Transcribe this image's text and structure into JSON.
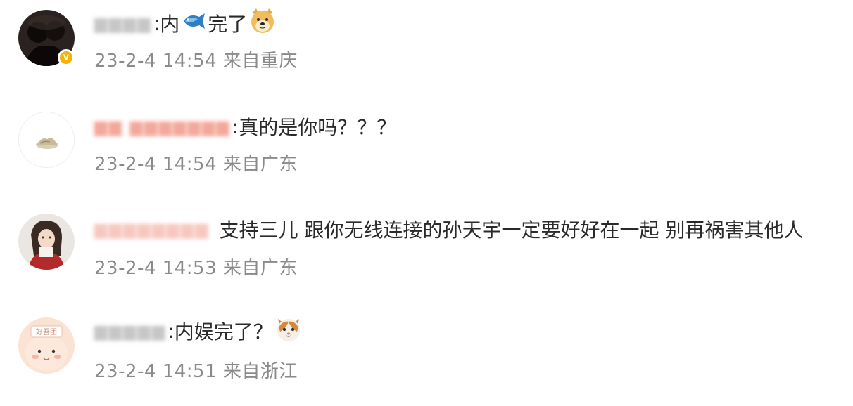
{
  "comments": [
    {
      "separator": ":",
      "text_before_emoji": "内",
      "emoji": "fish-icon",
      "text_after_emoji": "完了",
      "trailing_emoji": "doge-icon",
      "timestamp": "23-2-4 14:54",
      "location": "来自重庆",
      "verified": true
    },
    {
      "separator": ":",
      "text": "真的是你吗？？？",
      "timestamp": "23-2-4 14:54",
      "location": "来自广东"
    },
    {
      "text": "支持三儿 跟你无线连接的孙天宇一定要好好在一起 别再祸害其他人",
      "timestamp": "23-2-4 14:53",
      "location": "来自广东"
    },
    {
      "separator": ":",
      "text": "内娱完了？",
      "trailing_emoji": "cat-icon",
      "timestamp": "23-2-4 14:51",
      "location": "来自浙江",
      "avatar_text": "好吾团"
    }
  ],
  "colors": {
    "text": "#2a2a2a",
    "meta": "#8a8a8a",
    "verified_badge": "#f5b400"
  }
}
